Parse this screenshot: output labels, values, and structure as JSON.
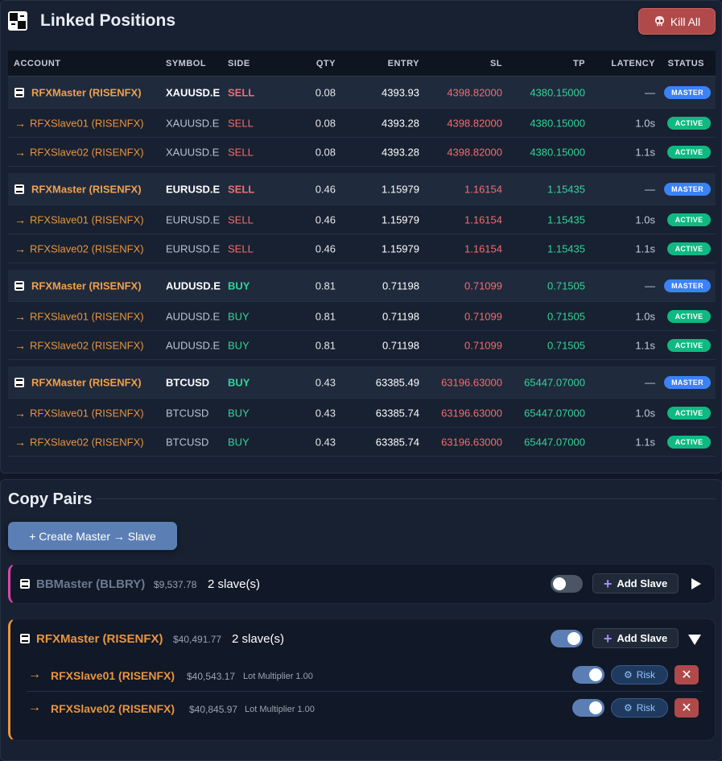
{
  "header": {
    "title": "Linked Positions",
    "kill_all_label": "Kill All"
  },
  "columns": [
    "ACCOUNT",
    "SYMBOL",
    "SIDE",
    "QTY",
    "ENTRY",
    "SL",
    "TP",
    "LATENCY",
    "STATUS"
  ],
  "groups": [
    {
      "master": {
        "account": "RFXMaster (RISENFX)",
        "symbol": "XAUUSD.E",
        "side": "SELL",
        "qty": "0.08",
        "entry": "4393.93",
        "sl": "4398.82000",
        "tp": "4380.15000",
        "latency": "—",
        "status": "MASTER"
      },
      "slaves": [
        {
          "account": "RFXSlave01 (RISENFX)",
          "symbol": "XAUUSD.E",
          "side": "SELL",
          "qty": "0.08",
          "entry": "4393.28",
          "sl": "4398.82000",
          "tp": "4380.15000",
          "latency": "1.0s",
          "status": "ACTIVE"
        },
        {
          "account": "RFXSlave02 (RISENFX)",
          "symbol": "XAUUSD.E",
          "side": "SELL",
          "qty": "0.08",
          "entry": "4393.28",
          "sl": "4398.82000",
          "tp": "4380.15000",
          "latency": "1.1s",
          "status": "ACTIVE"
        }
      ]
    },
    {
      "master": {
        "account": "RFXMaster (RISENFX)",
        "symbol": "EURUSD.E",
        "side": "SELL",
        "qty": "0.46",
        "entry": "1.15979",
        "sl": "1.16154",
        "tp": "1.15435",
        "latency": "—",
        "status": "MASTER"
      },
      "slaves": [
        {
          "account": "RFXSlave01 (RISENFX)",
          "symbol": "EURUSD.E",
          "side": "SELL",
          "qty": "0.46",
          "entry": "1.15979",
          "sl": "1.16154",
          "tp": "1.15435",
          "latency": "1.0s",
          "status": "ACTIVE"
        },
        {
          "account": "RFXSlave02 (RISENFX)",
          "symbol": "EURUSD.E",
          "side": "SELL",
          "qty": "0.46",
          "entry": "1.15979",
          "sl": "1.16154",
          "tp": "1.15435",
          "latency": "1.1s",
          "status": "ACTIVE"
        }
      ]
    },
    {
      "master": {
        "account": "RFXMaster (RISENFX)",
        "symbol": "AUDUSD.E",
        "side": "BUY",
        "qty": "0.81",
        "entry": "0.71198",
        "sl": "0.71099",
        "tp": "0.71505",
        "latency": "—",
        "status": "MASTER"
      },
      "slaves": [
        {
          "account": "RFXSlave01 (RISENFX)",
          "symbol": "AUDUSD.E",
          "side": "BUY",
          "qty": "0.81",
          "entry": "0.71198",
          "sl": "0.71099",
          "tp": "0.71505",
          "latency": "1.0s",
          "status": "ACTIVE"
        },
        {
          "account": "RFXSlave02 (RISENFX)",
          "symbol": "AUDUSD.E",
          "side": "BUY",
          "qty": "0.81",
          "entry": "0.71198",
          "sl": "0.71099",
          "tp": "0.71505",
          "latency": "1.1s",
          "status": "ACTIVE"
        }
      ]
    },
    {
      "master": {
        "account": "RFXMaster (RISENFX)",
        "symbol": "BTCUSD",
        "side": "BUY",
        "qty": "0.43",
        "entry": "63385.49",
        "sl": "63196.63000",
        "tp": "65447.07000",
        "latency": "—",
        "status": "MASTER"
      },
      "slaves": [
        {
          "account": "RFXSlave01 (RISENFX)",
          "symbol": "BTCUSD",
          "side": "BUY",
          "qty": "0.43",
          "entry": "63385.74",
          "sl": "63196.63000",
          "tp": "65447.07000",
          "latency": "1.0s",
          "status": "ACTIVE"
        },
        {
          "account": "RFXSlave02 (RISENFX)",
          "symbol": "BTCUSD",
          "side": "BUY",
          "qty": "0.43",
          "entry": "63385.74",
          "sl": "63196.63000",
          "tp": "65447.07000",
          "latency": "1.1s",
          "status": "ACTIVE"
        }
      ]
    }
  ],
  "copy_pairs": {
    "title": "Copy Pairs",
    "create_label": "+ Create Master → Slave",
    "pairs": [
      {
        "name": "BBMaster (BLBRY)",
        "balance": "$9,537.78",
        "slave_count": "2 slave(s)",
        "enabled": false,
        "add_slave_label": "Add Slave",
        "accent": "#d946a8",
        "expanded": false
      },
      {
        "name": "RFXMaster (RISENFX)",
        "balance": "$40,491.77",
        "slave_count": "2 slave(s)",
        "enabled": true,
        "add_slave_label": "Add Slave",
        "accent": "#e8943f",
        "expanded": true,
        "slaves": [
          {
            "name": "RFXSlave01 (RISENFX)",
            "balance": "$40,543.17",
            "multiplier": "Lot Multiplier 1.00",
            "enabled": true,
            "risk_label": "Risk"
          },
          {
            "name": "RFXSlave02 (RISENFX)",
            "balance": "$40,845.97",
            "multiplier": "Lot Multiplier 1.00",
            "enabled": true,
            "risk_label": "Risk"
          }
        ]
      }
    ]
  },
  "colors": {
    "sell": "#f26d6d",
    "buy": "#34d399",
    "master_badge": "#3b82f6",
    "active_badge": "#10b981",
    "account": "#f0a04b"
  },
  "icons": {
    "app": "linked-squares-icon",
    "kill": "skull-icon",
    "master": "master-account-icon",
    "slave": "arrow-right-icon",
    "expand": "play-triangle-icon",
    "collapse": "triangle-down-icon",
    "risk": "gear-icon",
    "delete": "close-icon",
    "add": "plus-icon"
  }
}
